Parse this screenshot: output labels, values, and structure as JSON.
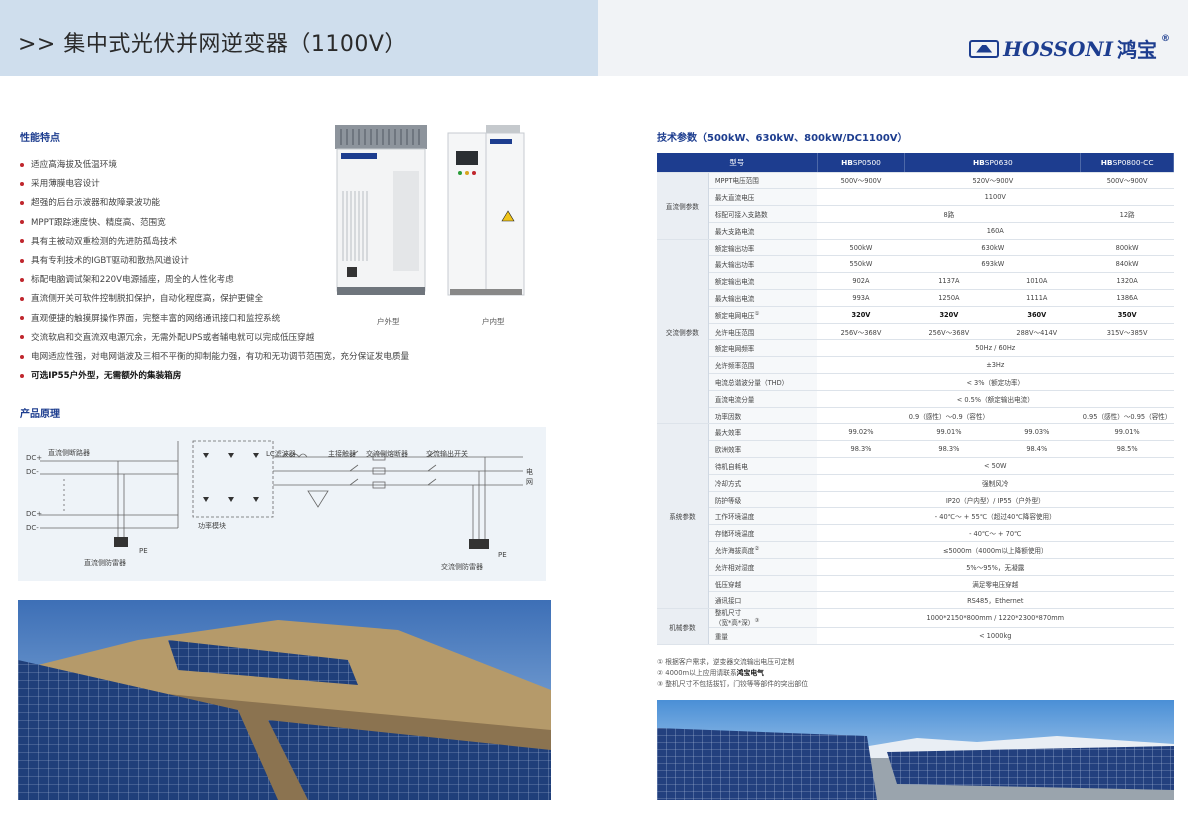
{
  "header": {
    "title": ">> 集中式光伏并网逆变器（1100V）",
    "logo_en": "HOSSONI",
    "logo_cn": "鸿宝",
    "logo_reg": "®"
  },
  "features": {
    "title": "性能特点",
    "items": [
      "适应高海拔及低温环境",
      "采用薄膜电容设计",
      "超强的后台示波器和故障录波功能",
      "MPPT跟踪速度快、精度高、范围宽",
      "具有主被动双重检测的先进防孤岛技术",
      "具有专利技术的IGBT驱动和散热风道设计",
      "标配电脑调试架和220V电源插座，周全的人性化考虑",
      "直流侧开关可软件控制脱扣保护，自动化程度高，保护更健全",
      "直观便捷的触摸屏操作界面，完整丰富的网络通讯接口和监控系统",
      "交流软启和交直流双电源冗余，无需外配UPS或者辅电就可以完成低压穿越",
      "电网适应性强，对电网谐波及三相不平衡的抑制能力强，有功和无功调节范围宽，充分保证发电质量"
    ],
    "highlight": "可选IP55户外型，无需额外的集装箱房"
  },
  "products": {
    "outdoor_caption": "户外型",
    "indoor_caption": "户内型",
    "cabinet_brand": "HOSSONI 鸿宝"
  },
  "principle": {
    "title": "产品原理",
    "labels": {
      "dc_plus_1": "DC+",
      "dc_minus_1": "DC-",
      "dc_plus_2": "DC+",
      "dc_minus_2": "DC-",
      "dc_breaker": "直流侧断路器",
      "lc_filter": "LC滤波器",
      "contactor": "主接触器",
      "ac_fuse": "交流侧熔断器",
      "ac_switch": "交流输出开关",
      "grid": "电\n网",
      "power_module": "功率模块",
      "pe1": "PE",
      "pe2": "PE",
      "dc_spd": "直流侧防雷器",
      "ac_spd": "交流侧防雷器"
    }
  },
  "spec": {
    "title": "技术参数（500kW、630kW、800kW/DC1100V）",
    "header": {
      "model": "型号",
      "m1_pfx": "HB",
      "m1": "SP0500",
      "m2_pfx": "HB",
      "m2": "SP0630",
      "m3_pfx": "HB",
      "m3": "SP0800-CC"
    },
    "groups": {
      "dc": "直流侧参数",
      "ac": "交流侧参数",
      "sys": "系统参数",
      "mech": "机械参数"
    },
    "rows": [
      {
        "p": "MPPT电压范围",
        "c": [
          "500V～900V",
          "",
          "520V～900V",
          "500V～900V"
        ],
        "span": false
      },
      {
        "p": "最大直流电压",
        "all": "1100V"
      },
      {
        "p": "标配可接入支路数",
        "c12": "8路",
        "c3": "12路"
      },
      {
        "p": "最大支路电流",
        "all": "160A"
      },
      {
        "p": "额定输出功率",
        "c1": "500kW",
        "c2": "630kW",
        "c3": "800kW"
      },
      {
        "p": "最大输出功率",
        "c1": "550kW",
        "c2": "693kW",
        "c3": "840kW"
      },
      {
        "p": "额定输出电流",
        "c": [
          "902A",
          "1137A",
          "1010A",
          "1320A"
        ]
      },
      {
        "p": "最大输出电流",
        "c": [
          "993A",
          "1250A",
          "1111A",
          "1386A"
        ]
      },
      {
        "p": "额定电网电压",
        "sup": "①",
        "c": [
          "320V",
          "320V",
          "360V",
          "350V"
        ],
        "bold": true
      },
      {
        "p": "允许电压范围",
        "c": [
          "256V～368V",
          "256V～368V",
          "288V～414V",
          "315V～385V"
        ]
      },
      {
        "p": "额定电网频率",
        "all": "50Hz / 60Hz"
      },
      {
        "p": "允许频率范围",
        "all": "±3Hz"
      },
      {
        "p": "电流总谐波分量（THD）",
        "all": "< 3%（额定功率）"
      },
      {
        "p": "直流电流分量",
        "all": "< 0.5%（额定输出电流）"
      },
      {
        "p": "功率因数",
        "c123": "0.9（感性）～0.9（容性）",
        "c3": "0.95（感性）～0.95（容性）"
      },
      {
        "p": "最大效率",
        "c": [
          "99.02%",
          "99.01%",
          "99.03%",
          "99.01%"
        ]
      },
      {
        "p": "欧洲效率",
        "c": [
          "98.3%",
          "98.3%",
          "98.4%",
          "98.5%"
        ]
      },
      {
        "p": "待机自耗电",
        "all": "< 50W"
      },
      {
        "p": "冷却方式",
        "all": "强制风冷"
      },
      {
        "p": "防护等级",
        "all": "IP20（户内型）/ IP55（户外型）"
      },
      {
        "p": "工作环境温度",
        "all": "- 40℃～ + 55℃（超过40℃降容使用）"
      },
      {
        "p": "存储环境温度",
        "all": "- 40℃～ + 70℃"
      },
      {
        "p": "允许海拔高度",
        "sup": "②",
        "all": "≤5000m（4000m以上降额使用）"
      },
      {
        "p": "允许相对湿度",
        "all": "5%～95%，无凝露"
      },
      {
        "p": "低压穿越",
        "all": "满足零电压穿越"
      },
      {
        "p": "通讯接口",
        "all": "RS485，Ethernet"
      },
      {
        "p": "整机尺寸\n（宽*高*深）",
        "sup": "③",
        "all": "1000*2150*800mm / 1220*2300*870mm"
      },
      {
        "p": "重量",
        "all": "< 1000kg"
      }
    ]
  },
  "notes": {
    "n1": "① 根据客户需求，逆变器交流输出电压可定制",
    "n2a": "② 4000m以上应用请联系",
    "n2b": "鸿宝电气",
    "n3": "③ 整机尺寸不包括拔钉，门铰等等部件的突出部位"
  }
}
